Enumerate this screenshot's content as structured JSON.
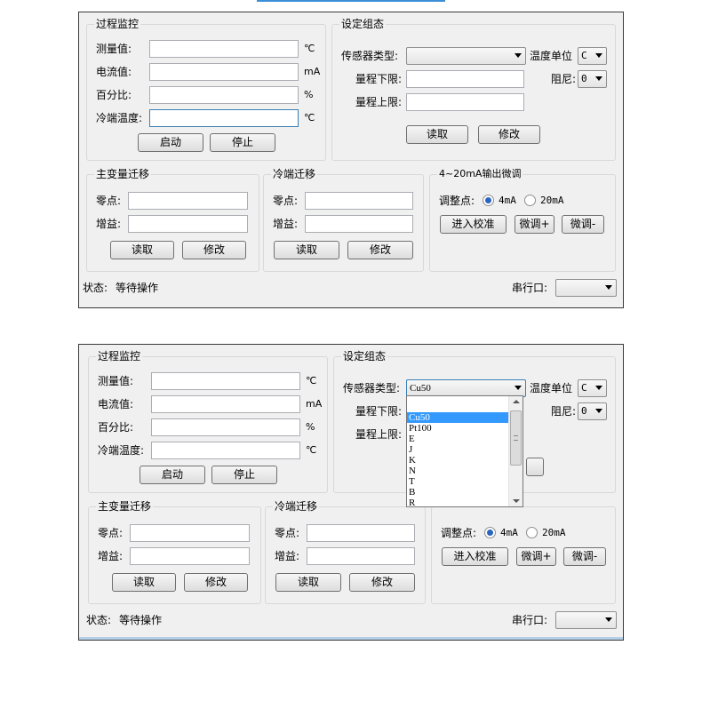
{
  "monitor": {
    "title": "过程监控",
    "measured_label": "测量值:",
    "current_label": "电流值:",
    "percent_label": "百分比:",
    "cold_label": "冷端温度:",
    "unit_c": "℃",
    "unit_ma": "mA",
    "unit_pct": "%",
    "start_button": "启动",
    "stop_button": "停止"
  },
  "config": {
    "title": "设定组态",
    "sensor_label": "传感器类型:",
    "lower_label": "量程下限:",
    "upper_label": "量程上限:",
    "temp_unit_label": "温度单位",
    "temp_unit_value": "C",
    "resistance_label": "阻尼:",
    "resistance_value": "0",
    "read_button": "读取",
    "modify_button": "修改"
  },
  "primary_shift": {
    "title": "主变量迁移",
    "zero_label": "零点:",
    "gain_label": "增益:",
    "read_button": "读取",
    "modify_button": "修改"
  },
  "cold_shift": {
    "title": "冷端迁移",
    "zero_label": "零点:",
    "gain_label": "增益:",
    "read_button": "读取",
    "modify_button": "修改"
  },
  "trim": {
    "title": "4~20mA输出微调",
    "adjust_label": "调整点:",
    "option_4ma": "4mA",
    "option_20ma": "20mA",
    "enter_button": "进入校准",
    "up_button": "微调+",
    "down_button": "微调-"
  },
  "status": {
    "label": "状态:",
    "value": "等待操作",
    "port_label": "串行口:"
  },
  "window2": {
    "sensor_value": "Cu50",
    "dropdown_items": [
      "Cu50",
      "Pt100",
      "E",
      "J",
      "K",
      "N",
      "T",
      "B",
      "R"
    ]
  },
  "colors": {
    "window_bg": "#f0f0f0",
    "selection": "#3399ff",
    "radio_dot": "#2a66c0",
    "top_accent": "#3b8fd8"
  }
}
